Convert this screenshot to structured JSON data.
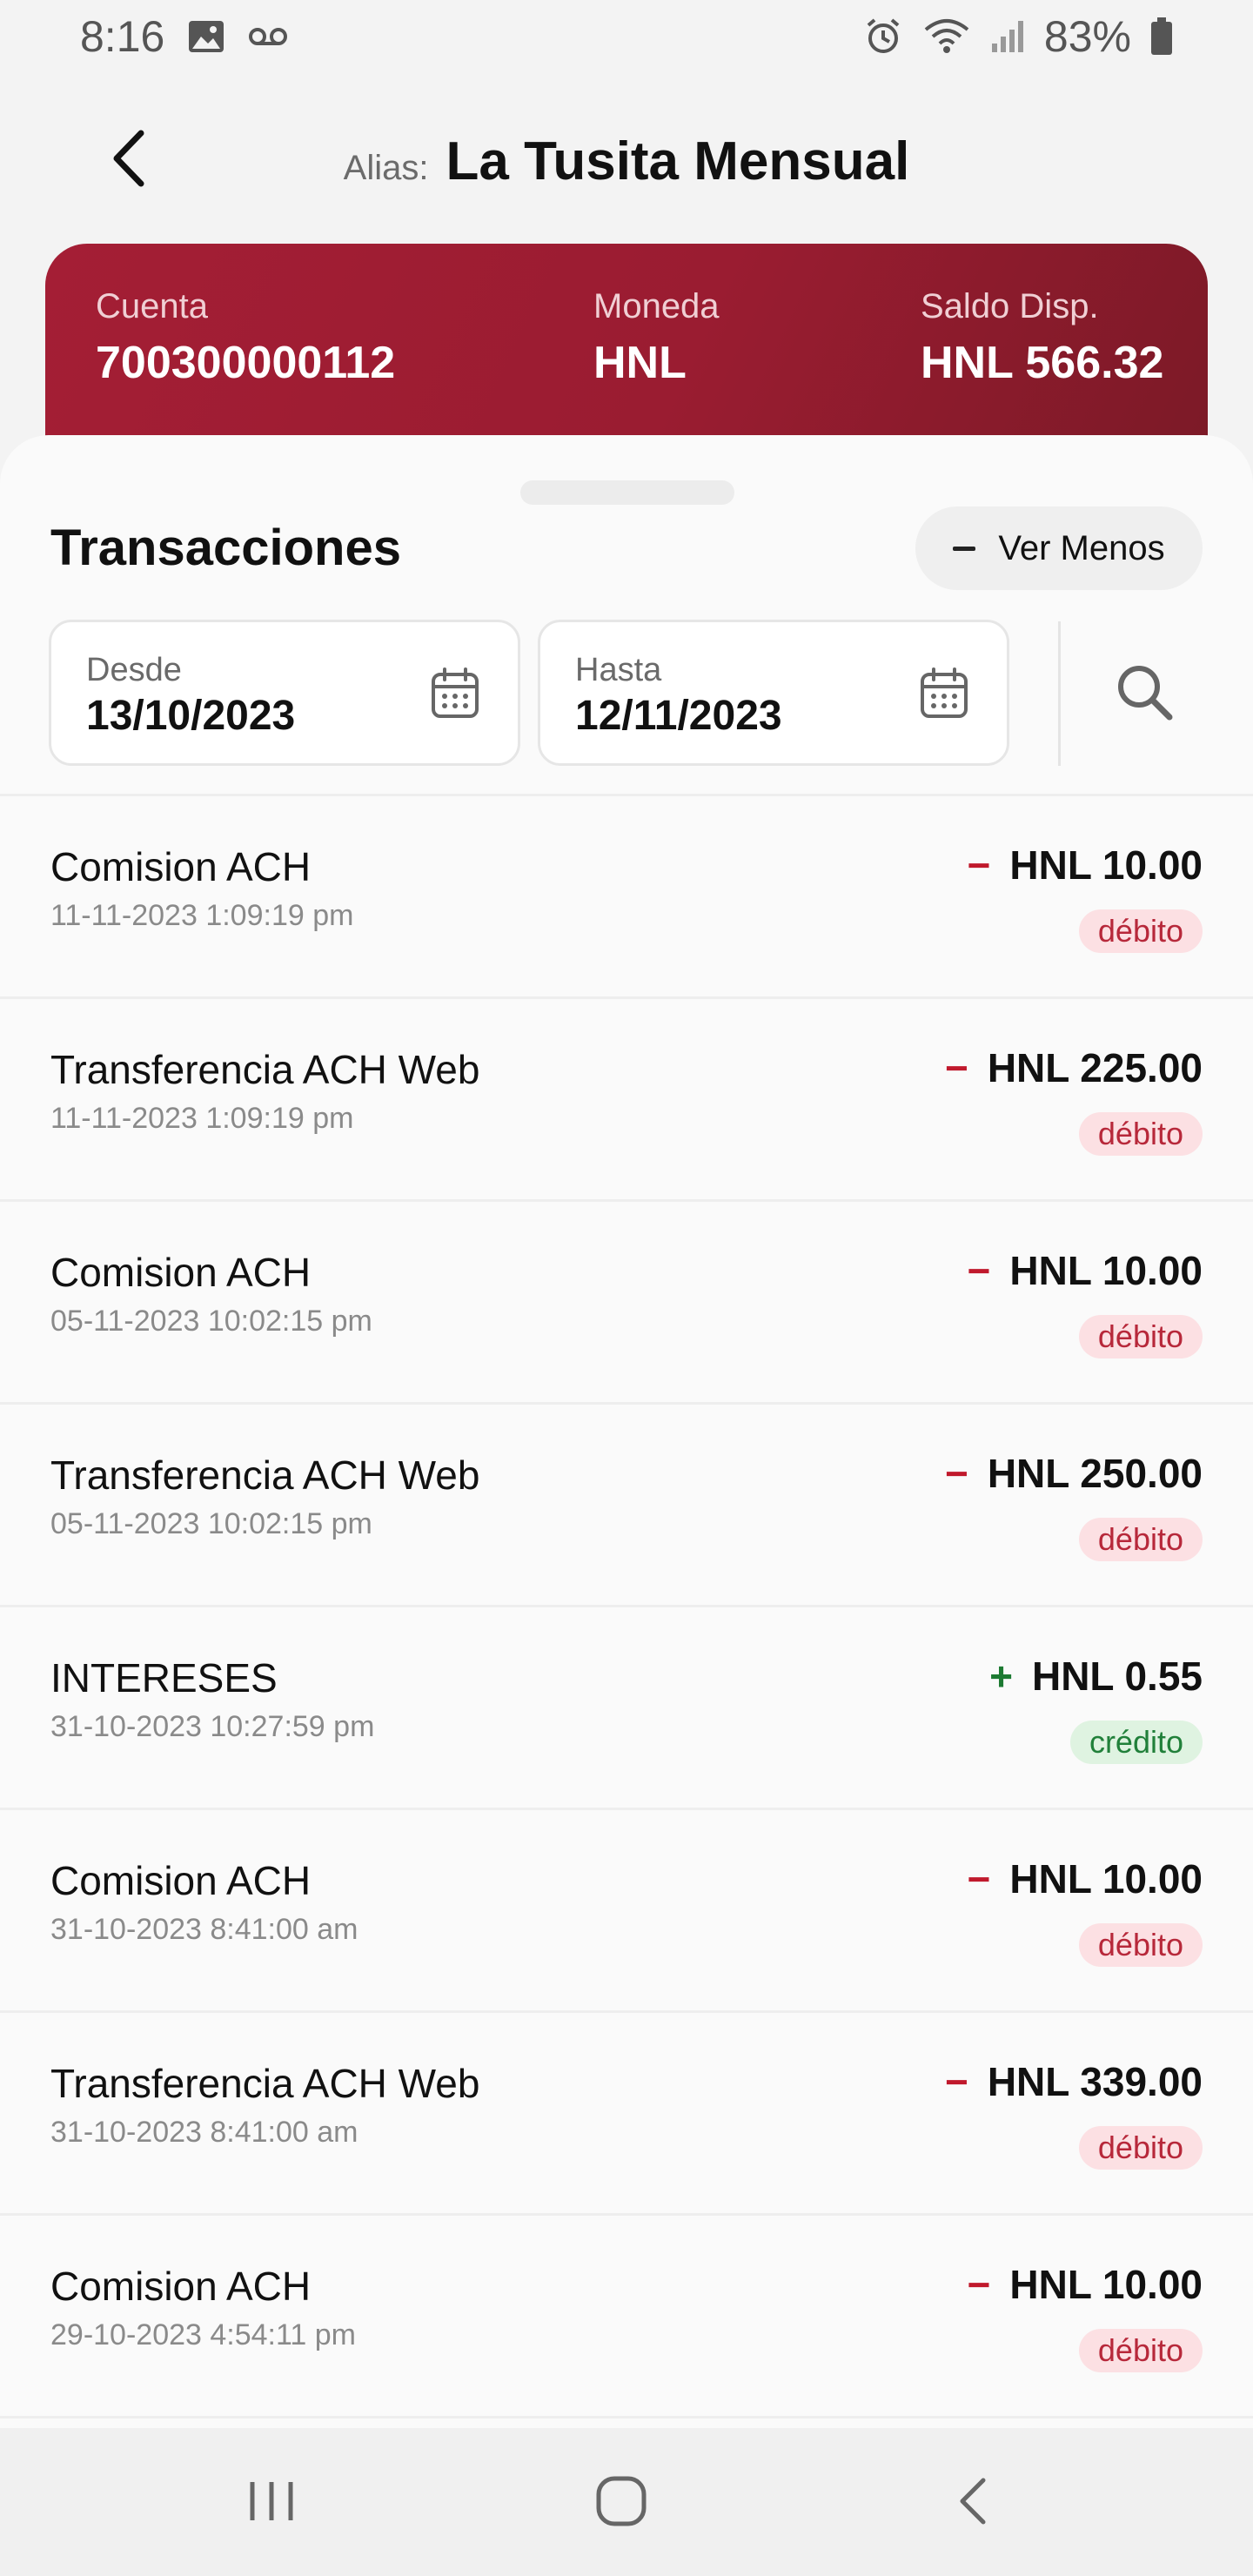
{
  "status_bar": {
    "time": "8:16",
    "battery": "83%",
    "icons": [
      "image-icon",
      "voicemail-icon",
      "alarm-icon",
      "wifi-icon",
      "signal-icon",
      "battery-icon"
    ]
  },
  "header": {
    "alias_label": "Alias:",
    "alias_value": "La Tusita Mensual"
  },
  "account": {
    "cuenta_label": "Cuenta",
    "cuenta_value": "700300000112",
    "moneda_label": "Moneda",
    "moneda_value": "HNL",
    "saldo_label": "Saldo Disp.",
    "saldo_value": "HNL 566.32"
  },
  "transactions_section": {
    "title": "Transacciones",
    "toggle_label": "Ver Menos",
    "desde_label": "Desde",
    "desde_value": "13/10/2023",
    "hasta_label": "Hasta",
    "hasta_value": "12/11/2023"
  },
  "transactions": [
    {
      "description": "Comision ACH",
      "datetime": "11-11-2023 1:09:19 pm",
      "sign": "−",
      "amount": "HNL 10.00",
      "type": "débito"
    },
    {
      "description": "Transferencia ACH Web",
      "datetime": "11-11-2023 1:09:19 pm",
      "sign": "−",
      "amount": "HNL 225.00",
      "type": "débito"
    },
    {
      "description": "Comision ACH",
      "datetime": "05-11-2023 10:02:15 pm",
      "sign": "−",
      "amount": "HNL 10.00",
      "type": "débito"
    },
    {
      "description": "Transferencia ACH Web",
      "datetime": "05-11-2023 10:02:15 pm",
      "sign": "−",
      "amount": "HNL 250.00",
      "type": "débito"
    },
    {
      "description": "INTERESES",
      "datetime": "31-10-2023 10:27:59 pm",
      "sign": "+",
      "amount": "HNL 0.55",
      "type": "crédito"
    },
    {
      "description": "Comision ACH",
      "datetime": "31-10-2023 8:41:00 am",
      "sign": "−",
      "amount": "HNL 10.00",
      "type": "débito"
    },
    {
      "description": "Transferencia ACH Web",
      "datetime": "31-10-2023 8:41:00 am",
      "sign": "−",
      "amount": "HNL 339.00",
      "type": "débito"
    },
    {
      "description": "Comision ACH",
      "datetime": "29-10-2023 4:54:11 pm",
      "sign": "−",
      "amount": "HNL 10.00",
      "type": "débito"
    }
  ],
  "colors": {
    "brand_red": "#9e1d33",
    "debit_red": "#c0192c",
    "credit_green": "#1d7a32"
  }
}
